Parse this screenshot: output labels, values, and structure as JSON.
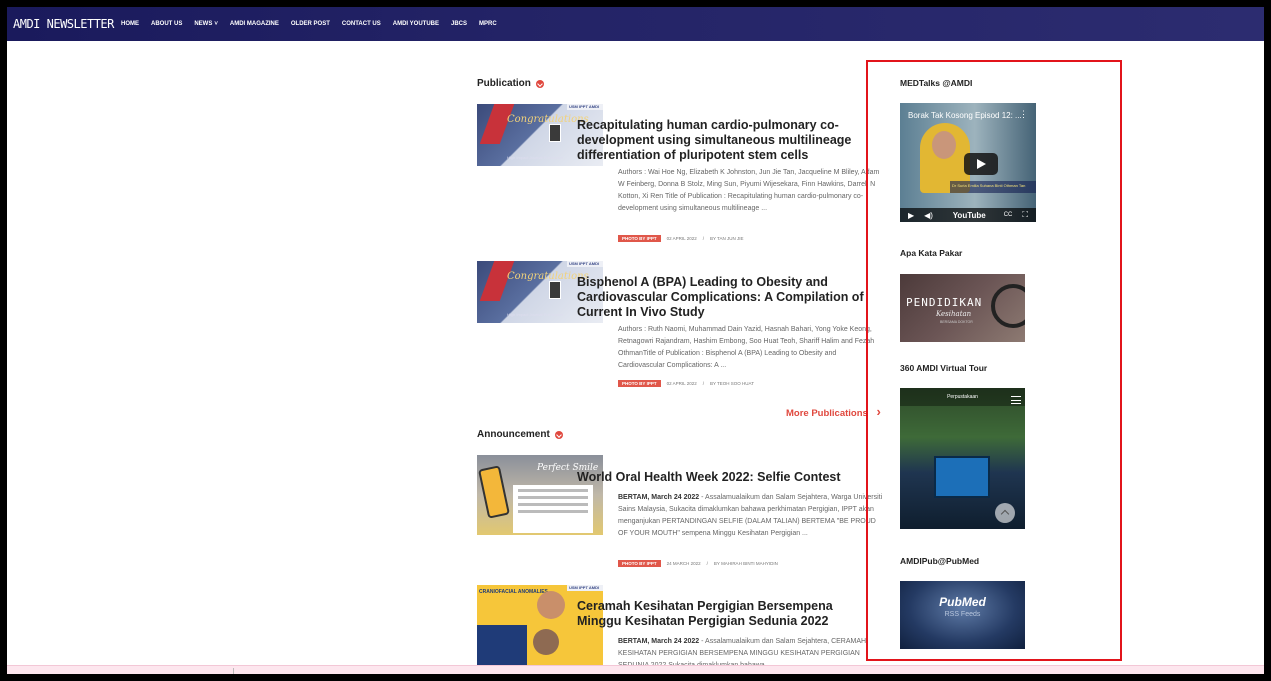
{
  "navbar": {
    "brand": "AMDI NEWSLETTER",
    "items": [
      "HOME",
      "ABOUT US",
      "NEWS",
      "AMDI MAGAZINE",
      "OLDER POST",
      "CONTACT US",
      "AMDI YOUTUBE",
      "JBCS",
      "MPRC"
    ],
    "news_caret": "˅"
  },
  "publication": {
    "heading": "Publication",
    "posts": [
      {
        "title": "Recapitulating human cardio-pulmonary co-development using simultaneous multilineage differentiation of pluripotent stem cells",
        "excerpt": "Authors : Wai Hoe Ng, Elizabeth K Johnston, Jun Jie Tan, Jacqueline M Bliley, Adam W Feinberg, Donna B Stolz, Ming Sun, Piyumi Wijesekara, Finn Hawkins, Darrell N Kotton, Xi Ren Title of Publication : Recapitulating human cardio-pulmonary co-development using simultaneous multilineage ...",
        "badge": "PHOTO BY IPPT",
        "date": "02 APRIL 2022",
        "author": "BY TAN JUN JIE"
      },
      {
        "title": "Bisphenol A (BPA) Leading to Obesity and Cardiovascular Complications: A Compilation of Current In Vivo Study",
        "excerpt": "Authors : Ruth Naomi, Muhammad Dain Yazid, Hasnah Bahari, Yong Yoke Keong, Retnagowri Rajandram, Hashim Embong, Soo Huat Teoh, Shariff Halim and Fezah OthmanTitle of Publication : Bisphenol A (BPA) Leading to Obesity and Cardiovascular Complications: A ...",
        "badge": "PHOTO BY IPPT",
        "date": "02 APRIL 2022",
        "author": "BY TEOH SOO HUAT"
      }
    ],
    "more_label": "More Publications",
    "more_arrow": "›"
  },
  "announcement": {
    "heading": "Announcement",
    "posts": [
      {
        "title": "World Oral Health Week 2022: Selfie Contest",
        "lead": "BERTAM, March 24 2022",
        "excerpt": " - Assalamualaikum dan Salam Sejahtera, Warga Universiti Sains Malaysia, Sukacita dimaklumkan bahawa perkhimatan Pergigian, IPPT akan menganjukan PERTANDINGAN SELFIE (DALAM TALIAN) BERTEMA \"BE PROUD OF YOUR MOUTH\" sempena Minggu Kesihatan Pergigian ...",
        "badge": "PHOTO BY IPPT",
        "date": "24 MARCH 2022",
        "author": "BY MAHIRAH BINTI MAHYIDIN"
      },
      {
        "title": "Ceramah Kesihatan Pergigian Bersempena Minggu Kesihatan Pergigian Sedunia 2022",
        "lead": "BERTAM, March 24 2022",
        "excerpt": " - Assalamualaikum dan Salam Sejahtera, CERAMAH KESIHATAN PERGIGIAN BERSEMPENA MINGGU KESIHATAN PERGIGIAN SEDUNIA 2022 Sukacita dimaklumkan bahawa"
      }
    ]
  },
  "thumbs": {
    "congrats_script": "Congratulations",
    "journal_caption": "High Impact Journal Publication",
    "logo_tag": "USM IPPT AMDI",
    "oral_script": "Perfect Smile",
    "ceramah_head": "CRANIOFACIAL ANOMALIES"
  },
  "sidebar": {
    "medtalks_title": "MEDTalks @AMDI",
    "video": {
      "title": "Borak Tak Kosong Episod 12: ...",
      "menu": "⋮",
      "nameplate": "Dr Suria Emilia Suhana Binti Othman Tan",
      "play": "▶",
      "volume": "◀)",
      "cc": "CC",
      "logo": "YouTube",
      "fullscreen": "⛶"
    },
    "pakar_title": "Apa Kata Pakar",
    "pakar_img": {
      "line1": "PENDIDIKAN",
      "line2": "Kesihatan",
      "line3": "BERSAMA DOKTOR"
    },
    "tour_title": "360 AMDI Virtual Tour",
    "tour_sign": "Perpustakaan",
    "pubmed_title": "AMDIPub@PubMed",
    "pubmed_img": {
      "line1": "PubMed",
      "line2": "RSS Feeds"
    }
  },
  "colors": {
    "accent": "#e0483e",
    "nav_bg": "#232366",
    "highlight_box": "#e2141b"
  }
}
